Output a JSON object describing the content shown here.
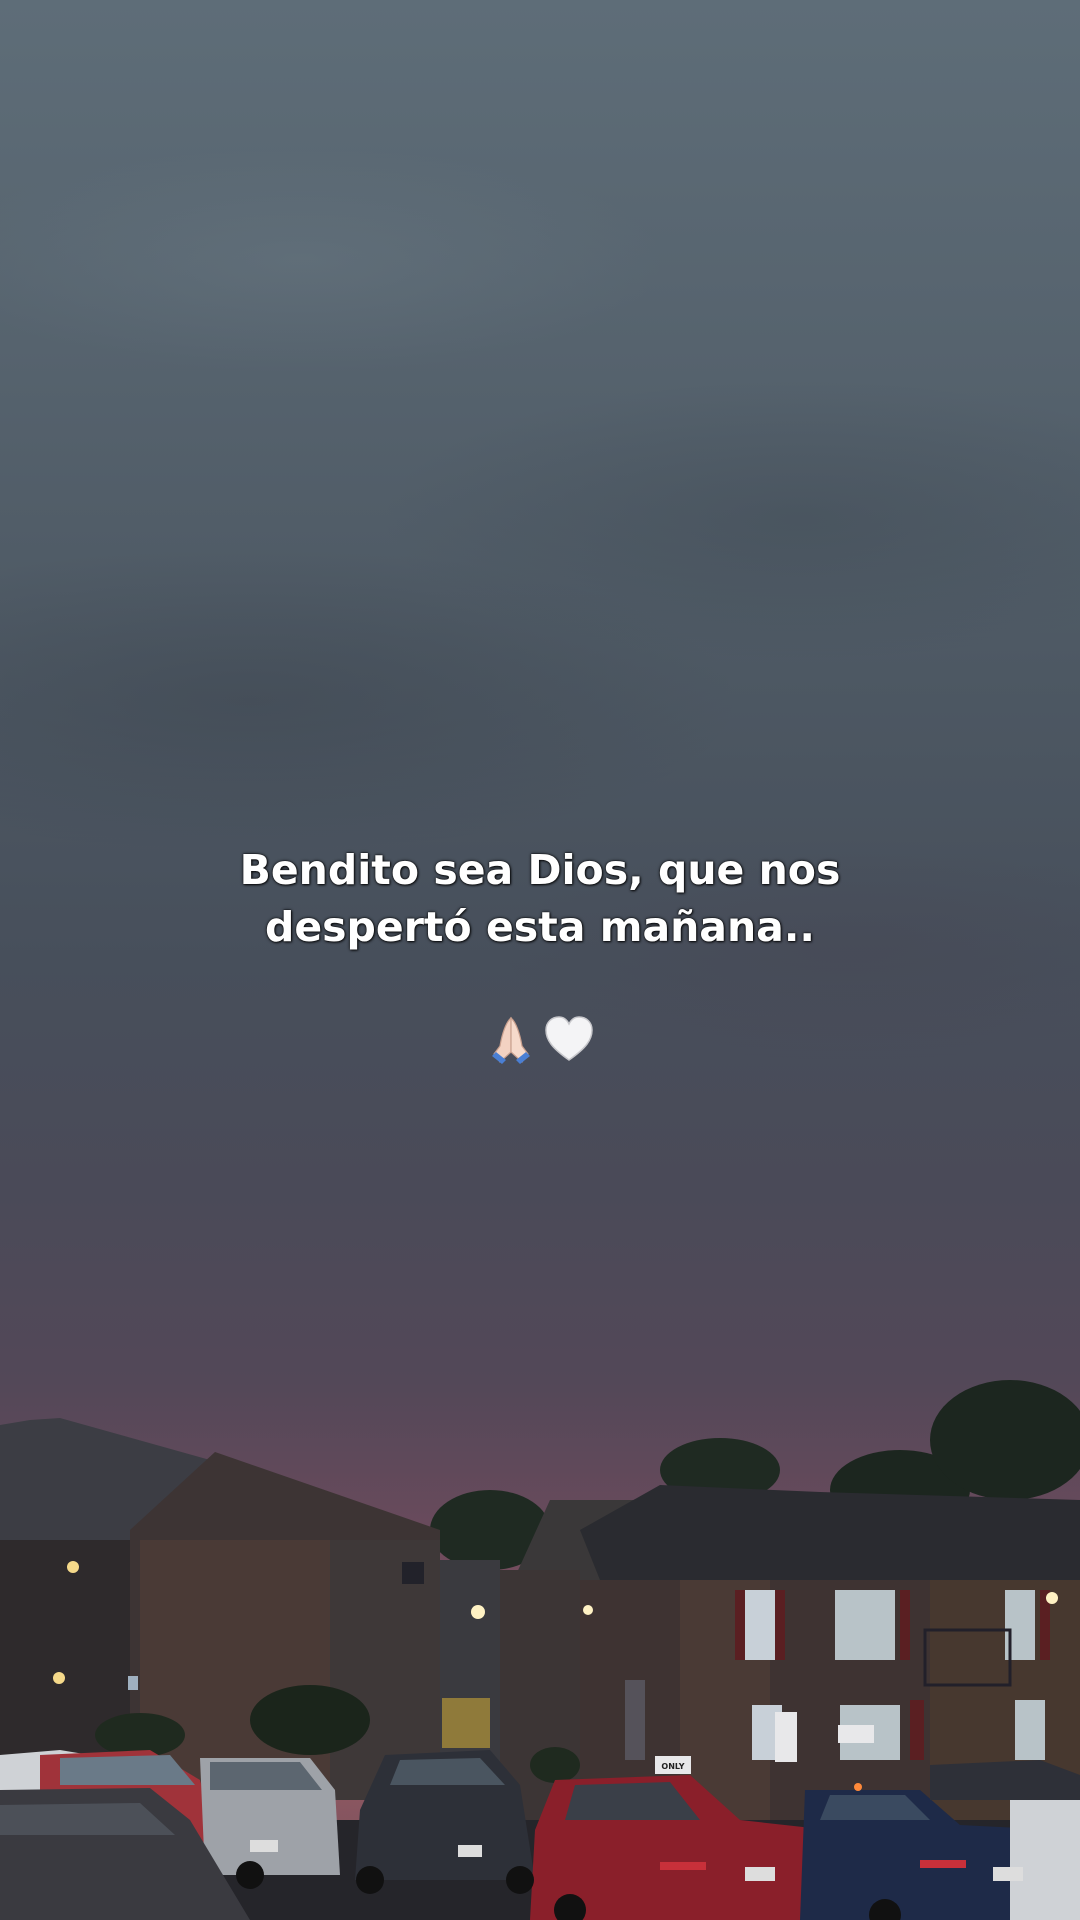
{
  "caption": {
    "line1": "Bendito sea Dios, que nos",
    "line2": "despertó esta mañana.."
  },
  "emojis": [
    "folded-hands-icon",
    "white-heart-icon"
  ],
  "signs": {
    "parking": "ONLY",
    "plate_left": "",
    "plate_mid": ""
  },
  "colors": {
    "sky_top": "#5e6d78",
    "sky_horizon": "#9a5a64",
    "text": "#ffffff"
  }
}
